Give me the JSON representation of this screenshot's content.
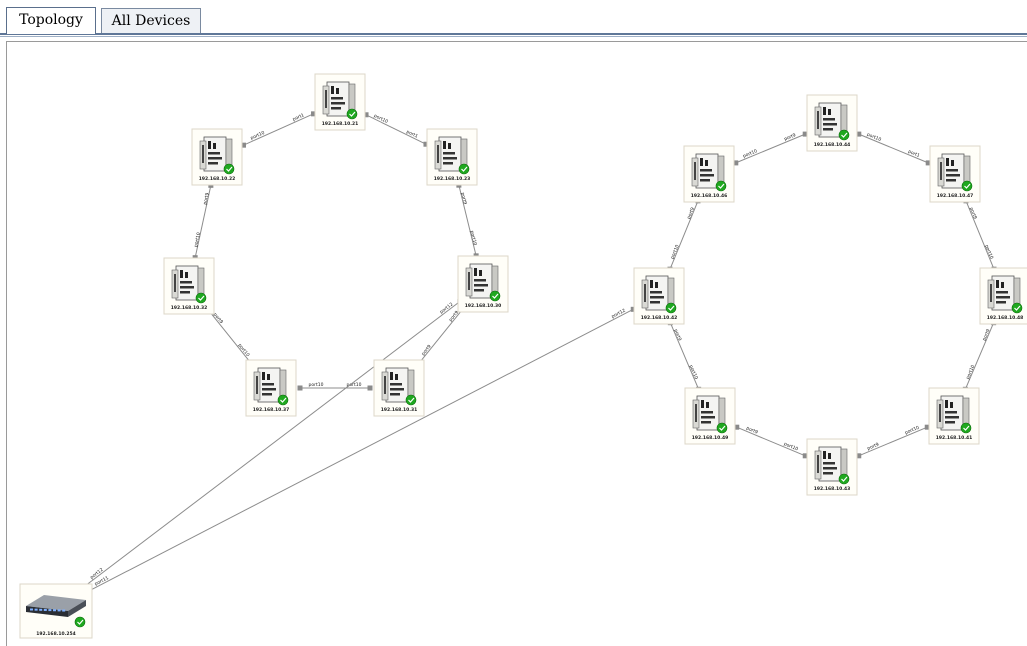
{
  "tabs": [
    {
      "label": "Topology",
      "active": true
    },
    {
      "label": "All Devices",
      "active": false
    }
  ],
  "colors": {
    "tab_border": "#5f7798",
    "link": "#8c8c8c",
    "status_ok": "#1fa81f"
  },
  "nodes": [
    {
      "id": "n21",
      "ip": "192.168.10.21",
      "icon": "industrial-switch-icon"
    },
    {
      "id": "n22",
      "ip": "192.168.10.22",
      "icon": "industrial-switch-icon"
    },
    {
      "id": "n23",
      "ip": "192.168.10.23",
      "icon": "industrial-switch-icon"
    },
    {
      "id": "n32",
      "ip": "192.168.10.32",
      "icon": "industrial-switch-icon"
    },
    {
      "id": "n37",
      "ip": "192.168.10.37",
      "icon": "industrial-switch-icon"
    },
    {
      "id": "n31",
      "ip": "192.168.10.31",
      "icon": "industrial-switch-icon"
    },
    {
      "id": "n30",
      "ip": "192.168.10.30",
      "icon": "industrial-switch-icon"
    },
    {
      "id": "n44",
      "ip": "192.168.10.44",
      "icon": "industrial-switch-icon"
    },
    {
      "id": "n46",
      "ip": "192.168.10.46",
      "icon": "industrial-switch-icon"
    },
    {
      "id": "n47",
      "ip": "192.168.10.47",
      "icon": "industrial-switch-icon"
    },
    {
      "id": "n42",
      "ip": "192.168.10.42",
      "icon": "industrial-switch-icon"
    },
    {
      "id": "n48",
      "ip": "192.168.10.48",
      "icon": "industrial-switch-icon"
    },
    {
      "id": "n49",
      "ip": "192.168.10.49",
      "icon": "industrial-switch-icon"
    },
    {
      "id": "n41",
      "ip": "192.168.10.41",
      "icon": "industrial-switch-icon"
    },
    {
      "id": "n43",
      "ip": "192.168.10.43",
      "icon": "industrial-switch-icon"
    },
    {
      "id": "n254",
      "ip": "192.168.10.254",
      "icon": "rack-switch-icon"
    }
  ],
  "links": [
    {
      "from": "n22",
      "to": "n21",
      "labels": [
        "port10",
        "port1"
      ]
    },
    {
      "from": "n21",
      "to": "n23",
      "labels": [
        "port10",
        "port1"
      ]
    },
    {
      "from": "n22",
      "to": "n32",
      "labels": [
        "port9",
        "port10"
      ]
    },
    {
      "from": "n23",
      "to": "n30",
      "labels": [
        "port9",
        "port10"
      ]
    },
    {
      "from": "n32",
      "to": "n37",
      "labels": [
        "port9",
        "port10"
      ]
    },
    {
      "from": "n37",
      "to": "n31",
      "labels": [
        "port10",
        "port10"
      ]
    },
    {
      "from": "n30",
      "to": "n31",
      "labels": [
        "port9",
        "port9"
      ]
    },
    {
      "from": "n46",
      "to": "n44",
      "labels": [
        "port10",
        "port9"
      ]
    },
    {
      "from": "n44",
      "to": "n47",
      "labels": [
        "port10",
        "port1"
      ]
    },
    {
      "from": "n46",
      "to": "n42",
      "labels": [
        "port9",
        "port10"
      ]
    },
    {
      "from": "n47",
      "to": "n48",
      "labels": [
        "port9",
        "port10"
      ]
    },
    {
      "from": "n42",
      "to": "n49",
      "labels": [
        "port9",
        "port10"
      ]
    },
    {
      "from": "n48",
      "to": "n41",
      "labels": [
        "port9",
        "port10"
      ]
    },
    {
      "from": "n49",
      "to": "n43",
      "labels": [
        "port9",
        "port10"
      ]
    },
    {
      "from": "n43",
      "to": "n41",
      "labels": [
        "port9",
        "port10"
      ]
    },
    {
      "from": "n254",
      "to": "n30",
      "labels": [
        "port12",
        "port12"
      ]
    },
    {
      "from": "n254",
      "to": "n42",
      "labels": [
        "port11",
        "port12"
      ]
    }
  ]
}
